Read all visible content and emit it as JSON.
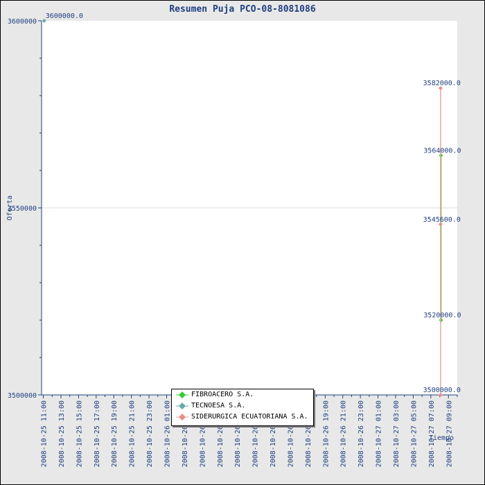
{
  "chart_data": {
    "type": "line",
    "title": "Resumen Puja PCO-08-8081086",
    "xlabel": "Tiempo",
    "ylabel": "Oferta",
    "ylim": [
      3500000,
      3600000
    ],
    "y_tick_labels": [
      "3600000",
      "3550000",
      "3500000"
    ],
    "x_tick_labels": [
      "2008-10-25 11:00",
      "2008-10-25 13:00",
      "2008-10-25 15:00",
      "2008-10-25 17:00",
      "2008-10-25 19:00",
      "2008-10-25 21:00",
      "2008-10-25 23:00",
      "2008-10-26 01:00",
      "2008-10-26 03:00",
      "2008-10-26 05:00",
      "2008-10-26 07:00",
      "2008-10-26 09:00",
      "2008-10-26 11:00",
      "2008-10-26 13:00",
      "2008-10-26 15:00",
      "2008-10-26 17:00",
      "2008-10-26 19:00",
      "2008-10-26 21:00",
      "2008-10-26 23:00",
      "2008-10-27 01:00",
      "2008-10-27 03:00",
      "2008-10-27 05:00",
      "2008-10-27 07:00",
      "2008-10-27 09:00"
    ],
    "x_tick_hours": [
      0,
      2,
      4,
      6,
      8,
      10,
      12,
      14,
      16,
      18,
      20,
      22,
      24,
      26,
      28,
      30,
      32,
      34,
      36,
      38,
      40,
      42,
      44,
      46
    ],
    "xlim_hours": [
      -0.2,
      47
    ],
    "legend_position": "bottom-center",
    "grid": "horizontal line at 3550000",
    "series": [
      {
        "name": "FIBROACERO S.A.",
        "color": "#33cc33",
        "marker_color": "#33cc33",
        "points": [
          {
            "x": 45.15,
            "y": 3564000
          },
          {
            "x": 45.15,
            "y": 3554000
          },
          {
            "x": 45.15,
            "y": 3542000
          },
          {
            "x": 45.15,
            "y": 3520000
          }
        ],
        "labels": [
          {
            "value": 3564000.0,
            "text": "3564000.0"
          },
          {
            "value": 3520000.0,
            "text": "3520000.0"
          }
        ]
      },
      {
        "name": "TECNOESA S.A.",
        "color": "#66aaaa",
        "marker_color": "#66aaaa",
        "points": [
          {
            "x": 0.1,
            "y": 3600000
          }
        ],
        "labels": [
          {
            "value": 3600000.0,
            "text": "3600000.0"
          }
        ]
      },
      {
        "name": "SIDERURGICA ECUATORIANA S.A.",
        "color": "#e8a6a0",
        "marker_color": "#e89088",
        "points": [
          {
            "x": 45.1,
            "y": 3582000
          },
          {
            "x": 45.1,
            "y": 3545600
          },
          {
            "x": 45.1,
            "y": 3500000
          }
        ],
        "labels": [
          {
            "value": 3582000.0,
            "text": "3582000.0"
          },
          {
            "value": 3545600.0,
            "text": "3545600.0"
          },
          {
            "value": 3500000.0,
            "text": "3500000.0"
          }
        ]
      }
    ]
  }
}
